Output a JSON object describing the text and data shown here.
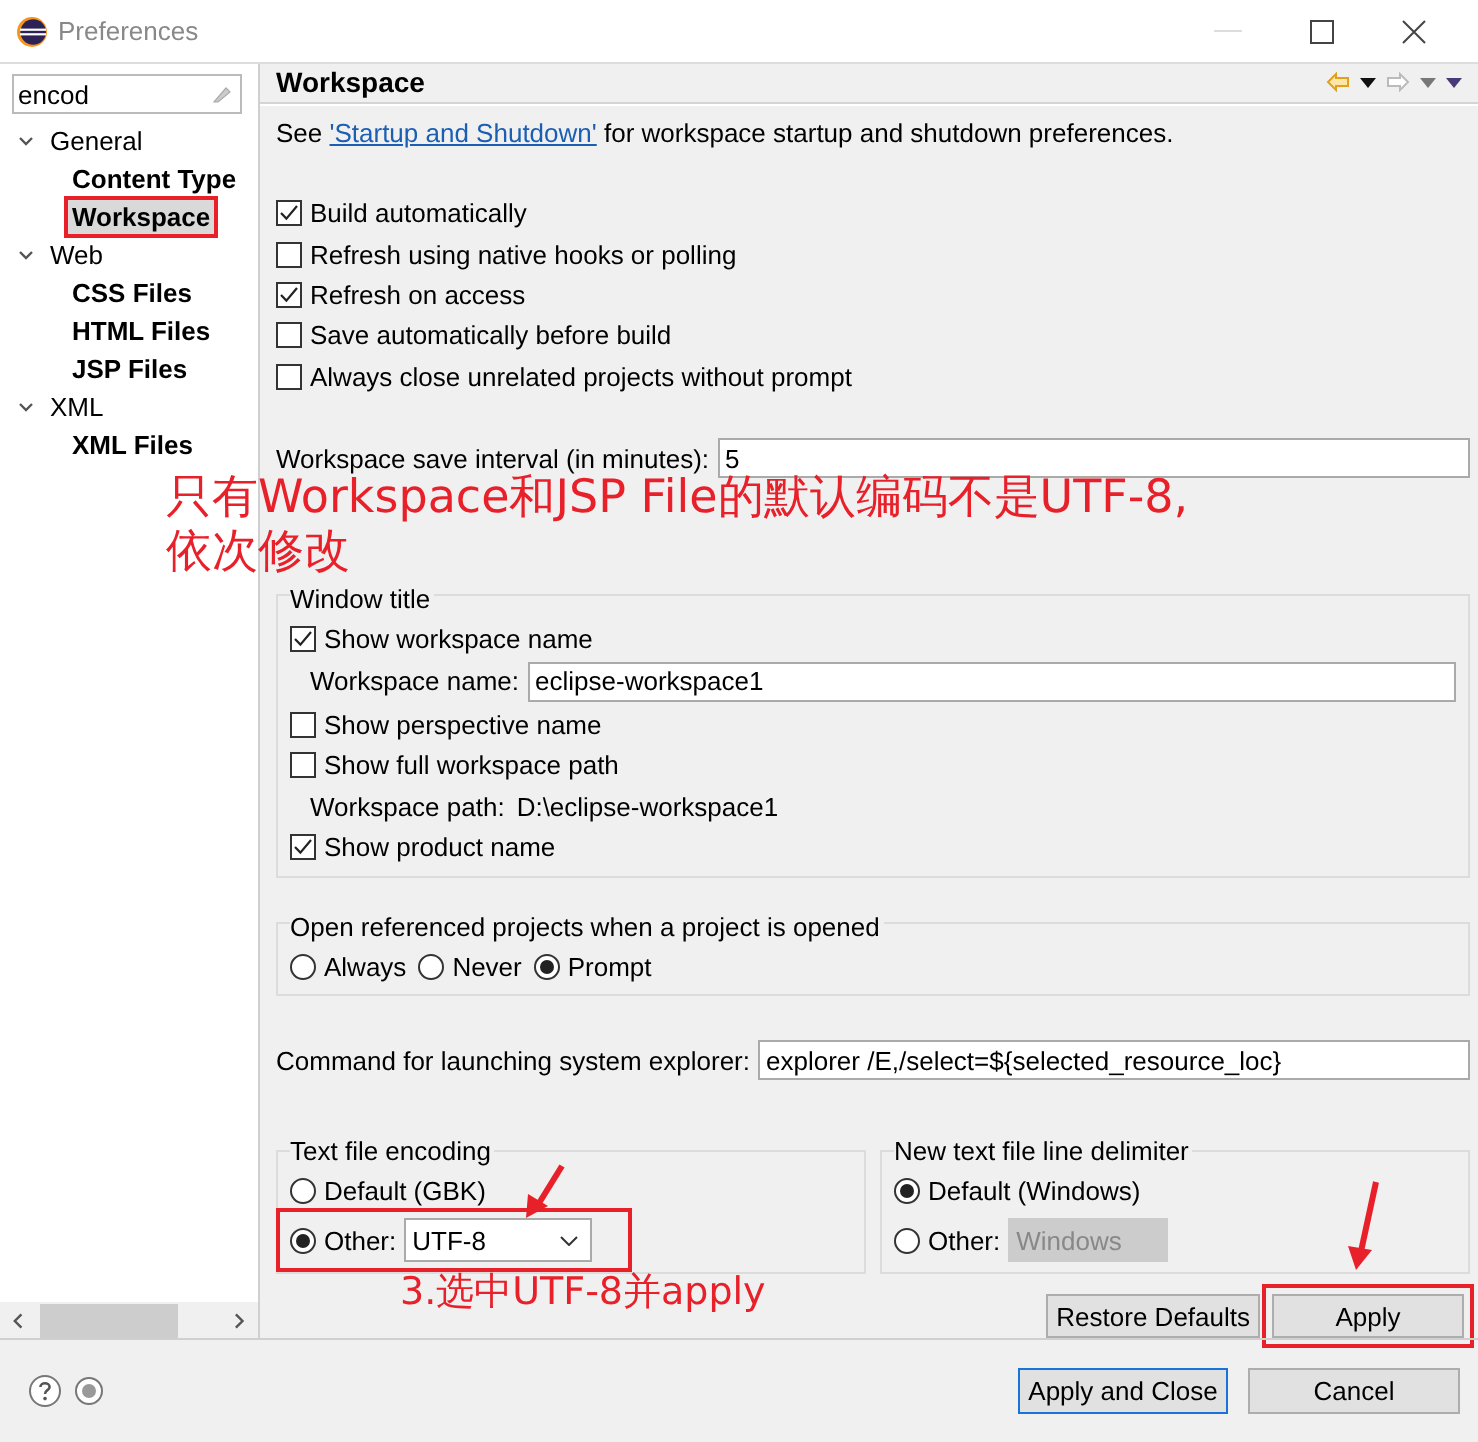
{
  "window": {
    "title": "Preferences"
  },
  "filter": {
    "value": "encod"
  },
  "tree": [
    {
      "label": "General",
      "expanded": true,
      "children": [
        {
          "label": "Content Type",
          "selected": false,
          "annotated": false
        },
        {
          "label": "Workspace",
          "selected": true,
          "annotated": true
        }
      ]
    },
    {
      "label": "Web",
      "expanded": true,
      "children": [
        {
          "label": "CSS Files",
          "selected": false,
          "annotated": false
        },
        {
          "label": "HTML Files",
          "selected": false,
          "annotated": false
        },
        {
          "label": "JSP Files",
          "selected": false,
          "annotated": false
        }
      ]
    },
    {
      "label": "XML",
      "expanded": true,
      "children": [
        {
          "label": "XML Files",
          "selected": false,
          "annotated": false
        }
      ]
    }
  ],
  "page": {
    "title": "Workspace",
    "intro_before": "See ",
    "intro_link": "'Startup and Shutdown'",
    "intro_after": " for workspace startup and shutdown preferences."
  },
  "options": [
    {
      "label": "Build automatically",
      "checked": true
    },
    {
      "label": "Refresh using native hooks or polling",
      "checked": false
    },
    {
      "label": "Refresh on access",
      "checked": true
    },
    {
      "label": "Save automatically before build",
      "checked": false
    },
    {
      "label": "Always close unrelated projects without prompt",
      "checked": false
    }
  ],
  "save_interval": {
    "label": "Workspace save interval (in minutes):",
    "value": "5"
  },
  "window_title": {
    "label": "Window title",
    "items": [
      {
        "kind": "checkbox",
        "label": "Show workspace name",
        "checked": true
      },
      {
        "kind": "field",
        "label": "Workspace name:",
        "value": "eclipse-workspace1"
      },
      {
        "kind": "checkbox",
        "label": "Show perspective name",
        "checked": false
      },
      {
        "kind": "checkbox",
        "label": "Show full workspace path",
        "checked": false
      },
      {
        "kind": "info",
        "label": "Workspace path:",
        "value": "D:\\eclipse-workspace1"
      },
      {
        "kind": "checkbox",
        "label": "Show product name",
        "checked": true
      }
    ]
  },
  "open_projects": {
    "label": "Open referenced projects when a project is opened",
    "options": [
      {
        "label": "Always",
        "selected": false
      },
      {
        "label": "Never",
        "selected": false
      },
      {
        "label": "Prompt",
        "selected": true
      }
    ]
  },
  "explorer_command": {
    "label": "Command for launching system explorer:",
    "value": "explorer /E,/select=${selected_resource_loc}"
  },
  "groups": [
    {
      "label": "Text file encoding",
      "options": [
        {
          "kind": "radio",
          "label": "Default (GBK)",
          "selected": false
        },
        {
          "kind": "select",
          "label": "Other:",
          "selected": true,
          "value": "UTF-8",
          "disabled": false,
          "annotated": true
        }
      ]
    },
    {
      "label": "New text file line delimiter",
      "options": [
        {
          "kind": "radio",
          "label": "Default (Windows)",
          "selected": true
        },
        {
          "kind": "select",
          "label": "Other:",
          "selected": false,
          "value": "Windows",
          "disabled": true,
          "annotated": false
        }
      ]
    }
  ],
  "page_buttons": [
    {
      "label": "Restore Defaults",
      "annotated": false
    },
    {
      "label": "Apply",
      "annotated": true
    }
  ],
  "footer_buttons": [
    {
      "label": "Apply and Close",
      "default": true
    },
    {
      "label": "Cancel",
      "default": false
    }
  ],
  "annotations": [
    {
      "kind": "note",
      "text": "只有Workspace和JSP File的默认编码不是UTF-8,\n依次修改"
    },
    {
      "kind": "step",
      "text": "3.选中UTF-8并apply"
    }
  ]
}
